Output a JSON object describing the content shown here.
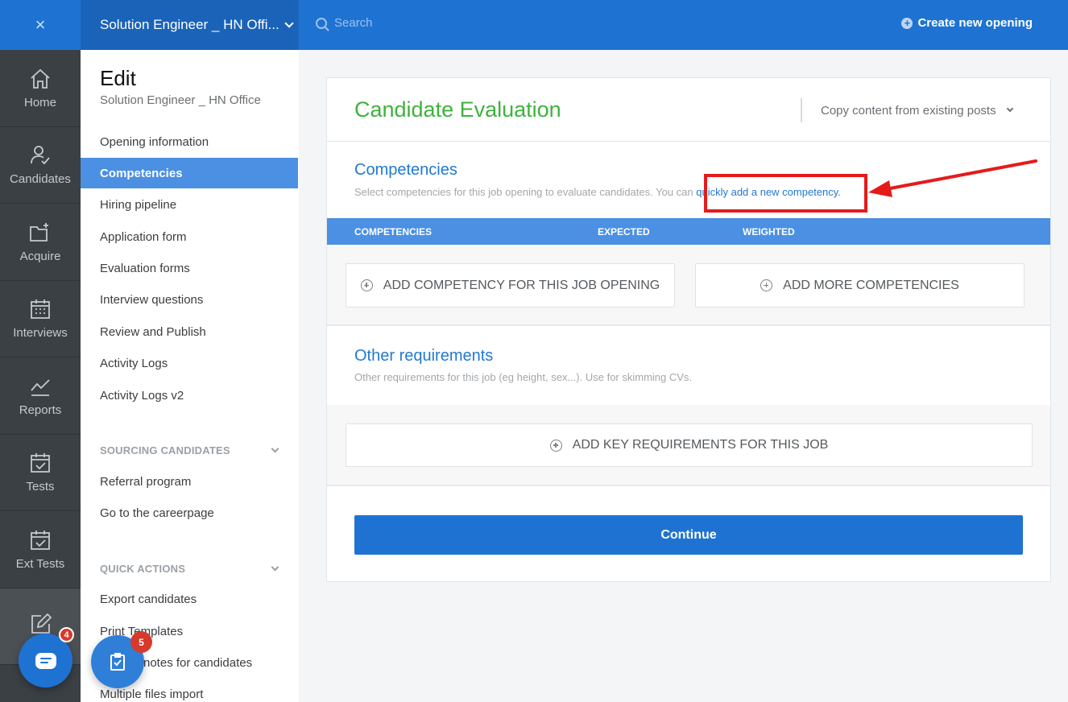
{
  "topbar": {
    "close_glyph": "×",
    "job_title": "Solution Engineer _ HN Offi...",
    "search_placeholder": "Search",
    "create_label": "Create new opening"
  },
  "rail": {
    "items": [
      {
        "label": "Home",
        "icon": "home-icon"
      },
      {
        "label": "Candidates",
        "icon": "candidates-icon"
      },
      {
        "label": "Acquire",
        "icon": "folder-plus-icon"
      },
      {
        "label": "Interviews",
        "icon": "calendar-icon"
      },
      {
        "label": "Reports",
        "icon": "chart-line-icon"
      },
      {
        "label": "Tests",
        "icon": "calendar-check-icon"
      },
      {
        "label": "Ext Tests",
        "icon": "calendar-check-icon"
      },
      {
        "label": "",
        "icon": "edit-icon"
      }
    ]
  },
  "sidebar": {
    "title": "Edit",
    "subtitle": "Solution Engineer _ HN Office",
    "links": [
      "Opening information",
      "Competencies",
      "Hiring pipeline",
      "Application form",
      "Evaluation forms",
      "Interview questions",
      "Review and Publish",
      "Activity Logs",
      "Activity Logs v2"
    ],
    "sourcing_header": "SOURCING CANDIDATES",
    "sourcing_links": [
      "Referral program",
      "Go to the careerpage"
    ],
    "quick_header": "QUICK ACTIONS",
    "quick_links": [
      "Export candidates",
      "Print Templates",
      "notes for candidates",
      "Multiple files import"
    ]
  },
  "card": {
    "title": "Candidate Evaluation",
    "copy_label": "Copy content from existing posts",
    "competencies": {
      "title": "Competencies",
      "desc_prefix": "Select competencies for this job opening to evaluate candidates. You can ",
      "desc_link": "quickly add a new competency.",
      "columns": [
        "COMPETENCIES",
        "EXPECTED",
        "WEIGHTED"
      ],
      "add_button": "ADD COMPETENCY FOR THIS JOB OPENING",
      "more_button": "ADD MORE COMPETENCIES"
    },
    "other": {
      "title": "Other requirements",
      "desc": "Other requirements for this job (eg height, sex...). Use for skimming CVs.",
      "add_button": "ADD KEY REQUIREMENTS FOR THIS JOB"
    },
    "continue_label": "Continue"
  },
  "floating": {
    "chat_badge": "4",
    "task_badge": "5"
  },
  "colors": {
    "brand_blue": "#1e73d2",
    "title_green": "#3db33c",
    "annotation_red": "#e51b1b"
  }
}
